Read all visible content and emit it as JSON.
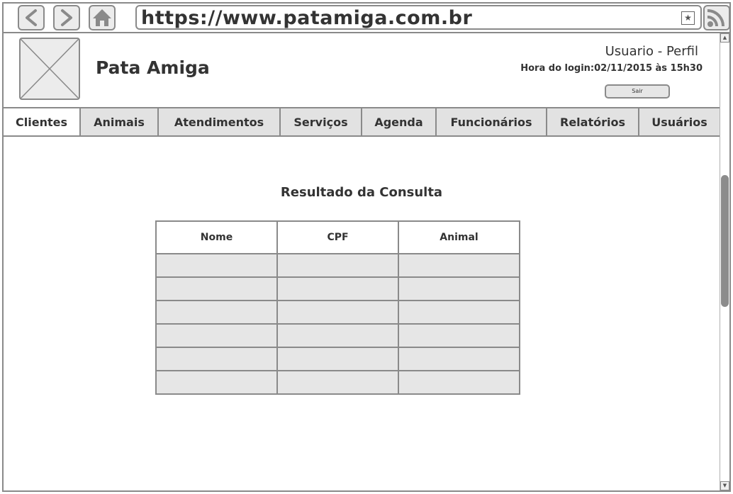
{
  "browser": {
    "url": "https://www.patamiga.com.br",
    "back_icon": "chevron-left-icon",
    "forward_icon": "chevron-right-icon",
    "home_icon": "home-icon",
    "bookmark_icon": "star-icon",
    "feed_icon": "rss-icon"
  },
  "header": {
    "logo_icon": "image-placeholder-icon",
    "site_title": "Pata Amiga",
    "user_title": "Usuario - Perfil",
    "login_time": "Hora do login:02/11/2015 às 15h30",
    "logout_label": "Sair"
  },
  "tabs": [
    {
      "label": "Clientes",
      "active": true
    },
    {
      "label": "Animais",
      "active": false
    },
    {
      "label": "Atendimentos",
      "active": false
    },
    {
      "label": "Serviços",
      "active": false
    },
    {
      "label": "Agenda",
      "active": false
    },
    {
      "label": "Funcionários",
      "active": false
    },
    {
      "label": "Relatórios",
      "active": false
    },
    {
      "label": "Usuários",
      "active": false
    }
  ],
  "main": {
    "result_title": "Resultado da Consulta",
    "table": {
      "columns": [
        "Nome",
        "CPF",
        "Animal"
      ],
      "rows": [
        [
          "",
          "",
          ""
        ],
        [
          "",
          "",
          ""
        ],
        [
          "",
          "",
          ""
        ],
        [
          "",
          "",
          ""
        ],
        [
          "",
          "",
          ""
        ],
        [
          "",
          "",
          ""
        ]
      ]
    }
  },
  "colors": {
    "border": "#8a8a8a",
    "fill": "#e6e6e6",
    "text": "#333333"
  }
}
